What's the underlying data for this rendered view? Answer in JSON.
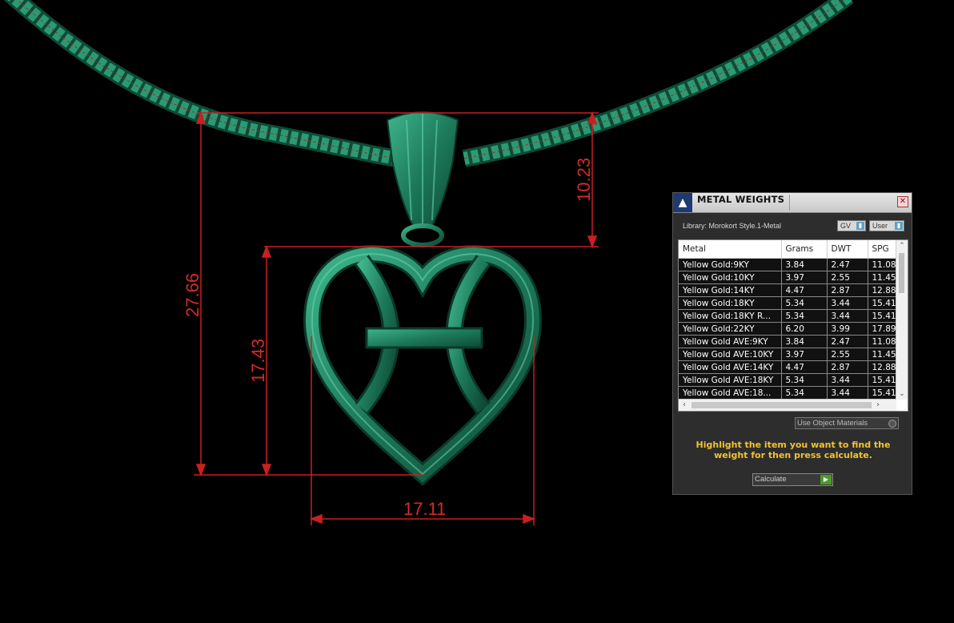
{
  "dimensions": {
    "total_height": "27.66",
    "heart_height": "17.43",
    "bail_height": "10.23",
    "width": "17.11"
  },
  "panel": {
    "title": "METAL WEIGHTS",
    "library_label": "Library: Morokort Style.1-Metal",
    "gv_label": "GV",
    "user_label": "User",
    "columns": [
      "Metal",
      "Grams",
      "DWT",
      "SPG"
    ],
    "rows": [
      [
        "Yellow Gold:9KY",
        "3.84",
        "2.47",
        "11.08"
      ],
      [
        "Yellow Gold:10KY",
        "3.97",
        "2.55",
        "11.45"
      ],
      [
        "Yellow Gold:14KY",
        "4.47",
        "2.87",
        "12.88"
      ],
      [
        "Yellow Gold:18KY",
        "5.34",
        "3.44",
        "15.41"
      ],
      [
        "Yellow Gold:18KY R...",
        "5.34",
        "3.44",
        "15.41"
      ],
      [
        "Yellow Gold:22KY",
        "6.20",
        "3.99",
        "17.89"
      ],
      [
        "Yellow Gold AVE:9KY",
        "3.84",
        "2.47",
        "11.08"
      ],
      [
        "Yellow Gold AVE:10KY",
        "3.97",
        "2.55",
        "11.45"
      ],
      [
        "Yellow Gold AVE:14KY",
        "4.47",
        "2.87",
        "12.88"
      ],
      [
        "Yellow Gold AVE:18KY",
        "5.34",
        "3.44",
        "15.41"
      ],
      [
        "Yellow Gold AVE:18...",
        "5.34",
        "3.44",
        "15.41"
      ]
    ],
    "use_object_materials": "Use Object Materials",
    "hint": "Highlight the item you want to find the weight for then press calculate.",
    "calculate_label": "Calculate"
  }
}
